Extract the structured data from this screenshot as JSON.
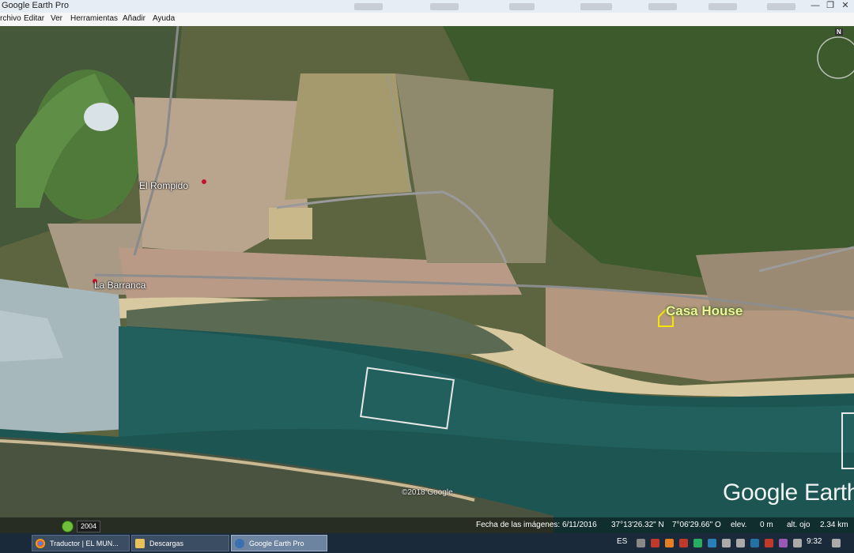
{
  "window": {
    "title": "Google Earth Pro",
    "controls": {
      "minimize": "—",
      "restore": "❐",
      "close": "✕"
    }
  },
  "menu": {
    "items": [
      "rchivo",
      "Editar",
      "Ver",
      "Herramientas",
      "Añadir",
      "Ayuda"
    ]
  },
  "map": {
    "labels": {
      "rompido": "El Rompido",
      "barranca": "La Barranca",
      "casa": "Casa House"
    },
    "watermark": "Google Earth",
    "copyright": "©2018 Google",
    "north_label": "N",
    "colors": {
      "water": "#1d5553",
      "shore_sand": "#d9c9a0",
      "vegetation": "#3c5a2c",
      "placemark": "#f2e600"
    }
  },
  "status_bar": {
    "history_year": "2004",
    "imagery_date": "Fecha de las imágenes: 6/11/2016",
    "latitude": "37°13'26.32\" N",
    "longitude": "7°06'29.66\" O",
    "elev_label": "elev.",
    "elev_value": "0 m",
    "eye_alt_label": "alt. ojo",
    "eye_alt_value": "2.34 km"
  },
  "taskbar": {
    "tasks": [
      {
        "label": "Traductor | EL MUN...",
        "icon": "chrome-icon"
      },
      {
        "label": "Descargas",
        "icon": "folder-icon"
      },
      {
        "label": "Google Earth Pro",
        "icon": "google-earth-icon"
      }
    ],
    "language": "ES",
    "clock": "9:32"
  }
}
